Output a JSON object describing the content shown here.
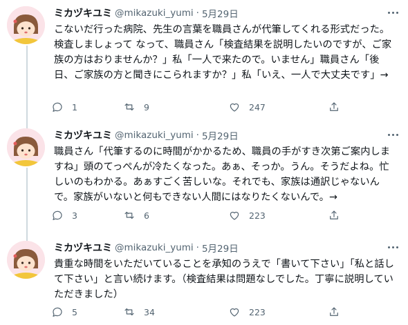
{
  "tweets": [
    {
      "name": "ミカヅキユミ",
      "handle": "@mikazuki_yumi",
      "separator": "·",
      "date": "5月29日",
      "text": "こないだ行った病院、先生の言葉を職員さんが代筆してくれる形式だった。検査しましょって なって、職員さん「検査結果を説明したいのですが、ご家族の方はおりませんか？」私「一人で来たので。いません」職員さん「後日、ご家族の方と聞きにこられますか？」私「いえ、一人で大丈夫です」→",
      "reply_count": "1",
      "retweet_count": "9",
      "like_count": "247"
    },
    {
      "name": "ミカヅキユミ",
      "handle": "@mikazuki_yumi",
      "separator": "·",
      "date": "5月29日",
      "text": "職員さん「代筆するのに時間がかかるため、職員の手がすき次第ご案内しますね」頭のてっぺんが冷たくなった。あぁ、そっか。うん。そうだよね。忙しいのもわかる。あぁすごく苦しいな。それでも、家族は通訳じゃないんで。家族がいないと何もできない人間にはなりたくないんで。→",
      "reply_count": "3",
      "retweet_count": "6",
      "like_count": "223"
    },
    {
      "name": "ミカヅキユミ",
      "handle": "@mikazuki_yumi",
      "separator": "·",
      "date": "5月29日",
      "text": "貴重な時間をいただいていることを承知のうえで「書いて下さい」「私と話して下さい」と言い続けます。（検査結果は問題なしでした。丁寧に説明していただきました）",
      "reply_count": "5",
      "retweet_count": "34",
      "like_count": "223"
    }
  ],
  "colors": {
    "text": "#0f1419",
    "secondary": "#536471",
    "thread_line": "#cfd9de",
    "avatar_bg": "#fbe3e8"
  }
}
